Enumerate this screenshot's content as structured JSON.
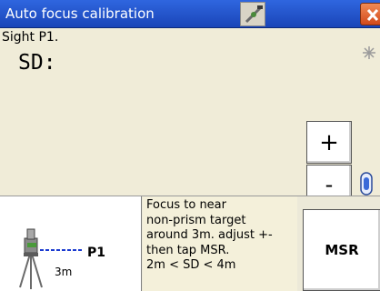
{
  "window": {
    "title": "Auto focus calibration",
    "title_icon": "instrument-icon",
    "close_icon": "close-icon"
  },
  "main": {
    "instruction": "Sight P1.",
    "sd_label": "SD:",
    "status_icon": "asterisk-icon"
  },
  "controls": {
    "plus_label": "+",
    "minus_label": "-",
    "dial_icon": "focus-dial-icon"
  },
  "diagram": {
    "target_label": "P1",
    "distance_label": "3m",
    "instrument_icon": "total-station-icon"
  },
  "help": {
    "lines": [
      "Focus to near",
      "non-prism target",
      "around 3m. adjust +-",
      "then tap MSR.",
      "2m < SD < 4m"
    ]
  },
  "actions": {
    "msr_label": "MSR"
  },
  "colors": {
    "titlebar": "#1f4fc8",
    "background": "#f0ecd8",
    "panel": "#ece9d8"
  }
}
